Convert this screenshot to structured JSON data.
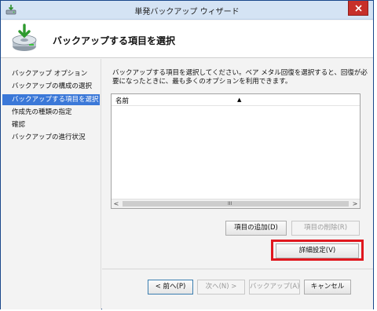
{
  "window": {
    "title": "単発バックアップ ウィザード",
    "close_icon": "close-icon"
  },
  "header": {
    "title": "バックアップする項目を選択",
    "icon": "backup-disk-icon"
  },
  "nav": {
    "items": [
      {
        "label": "バックアップ オプション",
        "active": false
      },
      {
        "label": "バックアップの構成の選択",
        "active": false
      },
      {
        "label": "バックアップする項目を選択",
        "active": true
      },
      {
        "label": "作成先の種類の指定",
        "active": false
      },
      {
        "label": "確認",
        "active": false
      },
      {
        "label": "バックアップの進行状況",
        "active": false
      }
    ]
  },
  "main": {
    "description": "バックアップする項目を選択してください。ベア メタル回復を選択すると、回復が必要になったときに、最も多くのオプションを利用できます。",
    "list": {
      "column_name": "名前",
      "sort_indicator": "▲",
      "scroll_left": "<",
      "scroll_right": ">",
      "scroll_grip": "III"
    },
    "buttons": {
      "add_item": "項目の追加(D)",
      "remove_item": "項目の削除(R)",
      "advanced_settings": "詳細設定(V)"
    }
  },
  "footer": {
    "back": "< 前へ(P)",
    "next": "次へ(N) >",
    "backup": "バックアップ(A)",
    "cancel": "キャンセル"
  },
  "colors": {
    "titlebar": "#d4e3f4",
    "nav_active": "#3b78d8",
    "highlight": "#e0181f",
    "close_button": "#c7302a"
  }
}
